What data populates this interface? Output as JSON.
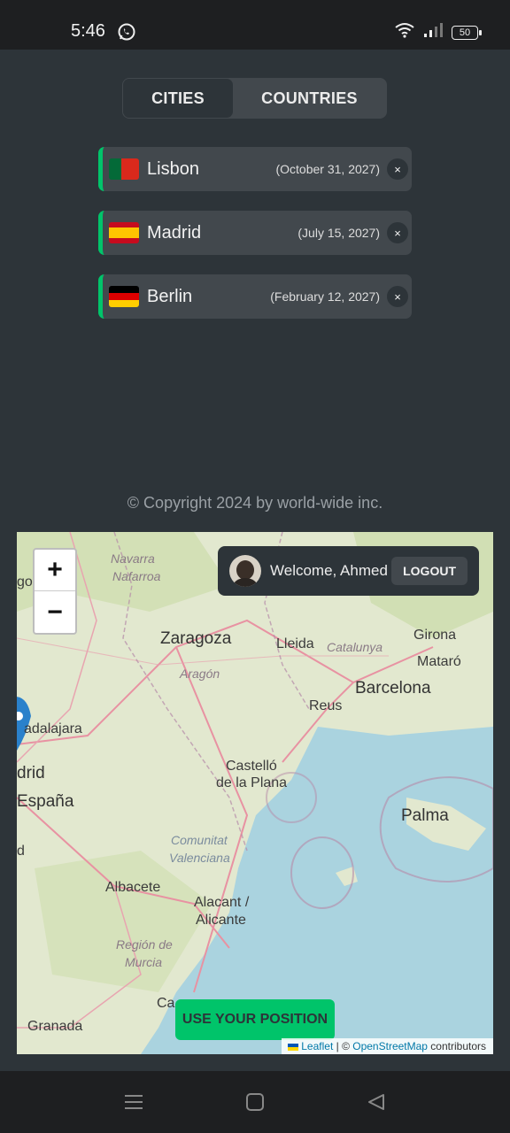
{
  "status_bar": {
    "time": "5:46",
    "battery": "50"
  },
  "tabs": [
    {
      "label": "CITIES",
      "active": true
    },
    {
      "label": "COUNTRIES",
      "active": false
    }
  ],
  "cities": [
    {
      "name": "Lisbon",
      "date": "(October 31, 2027)",
      "flag": "portugal-flag"
    },
    {
      "name": "Madrid",
      "date": "(July 15, 2027)",
      "flag": "spain-flag"
    },
    {
      "name": "Berlin",
      "date": "(February 12, 2027)",
      "flag": "germany-flag"
    }
  ],
  "delete_label": "×",
  "copyright": "© Copyright 2024 by world-wide inc.",
  "map": {
    "zoom_in": "+",
    "zoom_out": "−",
    "labels": {
      "navarra": "Navarra",
      "nafarroa": "Nafarroa",
      "zaragoza": "Zaragoza",
      "aragon": "Aragón",
      "lleida": "Lleida",
      "catalunya": "Catalunya",
      "girona": "Girona",
      "mataro": "Mataró",
      "barcelona": "Barcelona",
      "reus": "Reus",
      "guadalajara": "adalajara",
      "madrid": "drid",
      "espana": "España",
      "castello1": "Castelló",
      "castello2": "de la Plana",
      "palma": "Palma",
      "comunitat1": "Comunitat",
      "comunitat2": "Valenciana",
      "albacete": "Albacete",
      "alacant1": "Alacant /",
      "alacant2": "Alicante",
      "murcia1": "Región de",
      "murcia2": "Murcia",
      "granada": "Granada",
      "go": "go",
      "ca": "Ca",
      "d": "d"
    },
    "attribution": {
      "leaflet": "Leaflet",
      "sep": " | © ",
      "osm": "OpenStreetMap",
      "contributors": " contributors"
    }
  },
  "user": {
    "welcome": "Welcome, Ahmed",
    "logout": "LOGOUT"
  },
  "use_position": "USE YOUR POSITION",
  "colors": {
    "accent": "#00c46a",
    "panel": "#42484d",
    "background": "#2d3439"
  }
}
